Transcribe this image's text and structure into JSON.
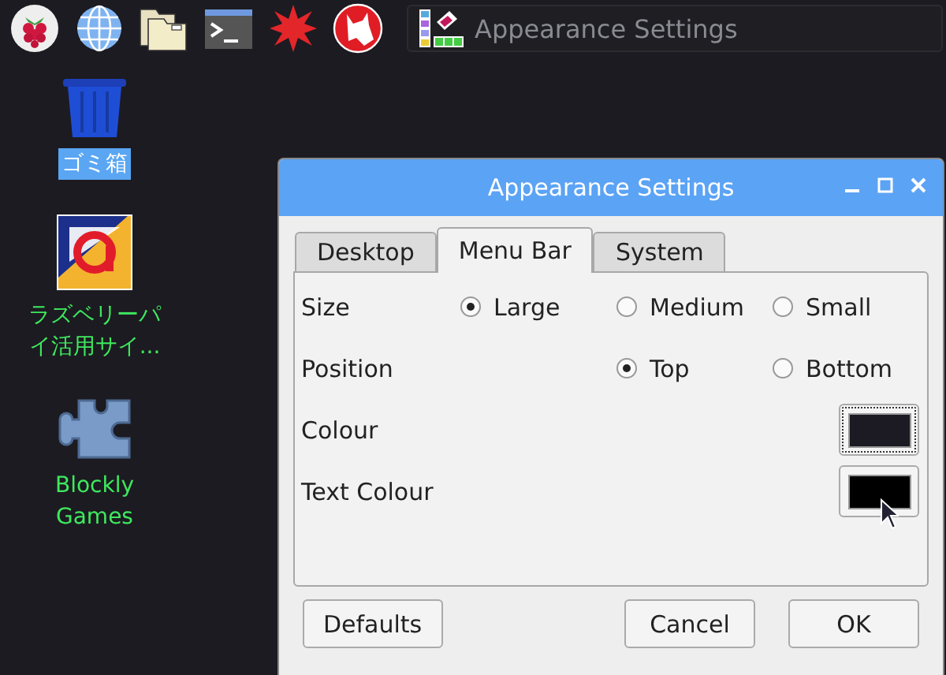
{
  "taskbar": {
    "task_button": {
      "title": "Appearance Settings"
    }
  },
  "desktop_icons": [
    {
      "kind": "trash",
      "label": "ゴミ箱",
      "selected": true
    },
    {
      "kind": "app",
      "label": "ラズベリーパイ活用サイ...",
      "selected": false
    },
    {
      "kind": "puzzle",
      "label": "Blockly Games",
      "selected": false
    }
  ],
  "window": {
    "title": "Appearance Settings",
    "tabs": [
      {
        "label": "Desktop",
        "selected": false
      },
      {
        "label": "Menu Bar",
        "selected": true
      },
      {
        "label": "System",
        "selected": false
      }
    ],
    "settings": [
      {
        "kind": "radio",
        "label": "Size",
        "options": [
          {
            "label": "Large",
            "selected": true
          },
          {
            "label": "Medium",
            "selected": false
          },
          {
            "label": "Small",
            "selected": false
          }
        ]
      },
      {
        "kind": "radio",
        "label": "Position",
        "options": [
          {
            "label": "Top",
            "selected": true
          },
          {
            "label": "Bottom",
            "selected": false
          }
        ]
      },
      {
        "kind": "color",
        "label": "Colour",
        "color": "#1c1a22",
        "focused": true
      },
      {
        "kind": "color",
        "label": "Text Colour",
        "color": "#000000",
        "focused": false
      }
    ],
    "buttons": [
      {
        "label": "Defaults"
      },
      {
        "label": "Cancel"
      },
      {
        "label": "OK"
      }
    ]
  }
}
